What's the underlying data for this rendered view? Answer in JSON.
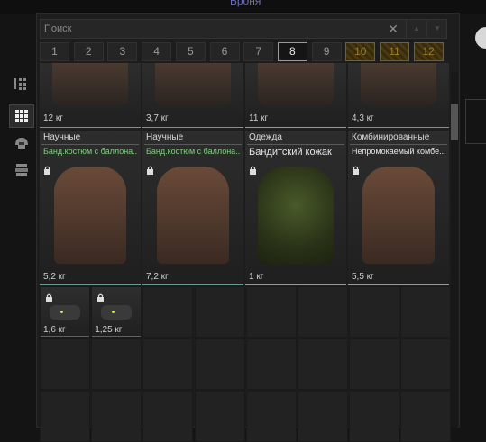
{
  "window": {
    "title": "Броня"
  },
  "search": {
    "placeholder": "Поиск",
    "clear_icon": "close-icon"
  },
  "pages": [
    {
      "label": "1",
      "state": "normal"
    },
    {
      "label": "2",
      "state": "normal"
    },
    {
      "label": "3",
      "state": "normal"
    },
    {
      "label": "4",
      "state": "normal"
    },
    {
      "label": "5",
      "state": "normal"
    },
    {
      "label": "6",
      "state": "normal"
    },
    {
      "label": "7",
      "state": "normal"
    },
    {
      "label": "8",
      "state": "active"
    },
    {
      "label": "9",
      "state": "normal"
    },
    {
      "label": "10",
      "state": "locked"
    },
    {
      "label": "11",
      "state": "locked"
    },
    {
      "label": "12",
      "state": "locked"
    }
  ],
  "sidebar": [
    {
      "icon": "sort-list-icon",
      "active": false
    },
    {
      "icon": "grid-view-icon",
      "active": true
    },
    {
      "icon": "helmet-icon",
      "active": false
    },
    {
      "icon": "armor-stack-icon",
      "active": false
    }
  ],
  "top_row": [
    {
      "weight": "12 кг",
      "accent": "#6a9a9a"
    },
    {
      "weight": "3,7 кг",
      "accent": "#6a9a9a"
    },
    {
      "weight": "11 кг",
      "accent": "#9a9a9a"
    },
    {
      "weight": "4,3 кг",
      "accent": "#6a9a9a"
    }
  ],
  "items": [
    {
      "category": "Научные",
      "name": "Банд.костюм с баллона...",
      "name_color": "#7fd07f",
      "weight": "5,2 кг",
      "locked": true,
      "accent": "#6a9a9a"
    },
    {
      "category": "Научные",
      "name": "Банд.костюм с баллона...",
      "name_color": "#7fd07f",
      "weight": "7,2 кг",
      "locked": true,
      "accent": "#6a9a9a"
    },
    {
      "category": "Одежда",
      "name": "Бандитский кожак",
      "name_color": "#e6e6e6",
      "weight": "1 кг",
      "locked": true,
      "accent": "#9a9a9a"
    },
    {
      "category": "Комбинированные",
      "name": "Непромокаемый комбе...",
      "name_color": "#e6e6e6",
      "weight": "5,5 кг",
      "locked": true,
      "accent": "#9a9a9a"
    }
  ],
  "small_items": [
    {
      "weight": "1,6 кг",
      "locked": true,
      "accent": "#7a4a9a"
    },
    {
      "weight": "1,25 кг",
      "locked": true,
      "accent": "#5a5aa0"
    }
  ]
}
